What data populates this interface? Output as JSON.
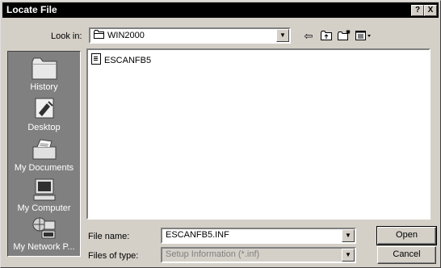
{
  "window": {
    "title": "Locate File",
    "help_label": "?",
    "close_label": "X"
  },
  "lookin": {
    "label": "Look in:",
    "value": "WIN2000"
  },
  "toolbar": {
    "back_icon": "back-arrow-icon",
    "up_icon": "up-folder-icon",
    "new_folder_icon": "new-folder-icon",
    "view_icon": "view-menu-icon"
  },
  "places": [
    {
      "label": "History",
      "icon": "history-icon"
    },
    {
      "label": "Desktop",
      "icon": "desktop-icon"
    },
    {
      "label": "My Documents",
      "icon": "my-documents-icon"
    },
    {
      "label": "My Computer",
      "icon": "my-computer-icon"
    },
    {
      "label": "My Network P...",
      "icon": "my-network-places-icon"
    }
  ],
  "files": [
    {
      "name": "ESCANFB5",
      "icon": "setup-info-file-icon"
    }
  ],
  "filename": {
    "label": "File name:",
    "value": "ESCANFB5.INF"
  },
  "filetype": {
    "label": "Files of type:",
    "value": "Setup Information (*.inf)"
  },
  "buttons": {
    "open": "Open",
    "cancel": "Cancel"
  }
}
